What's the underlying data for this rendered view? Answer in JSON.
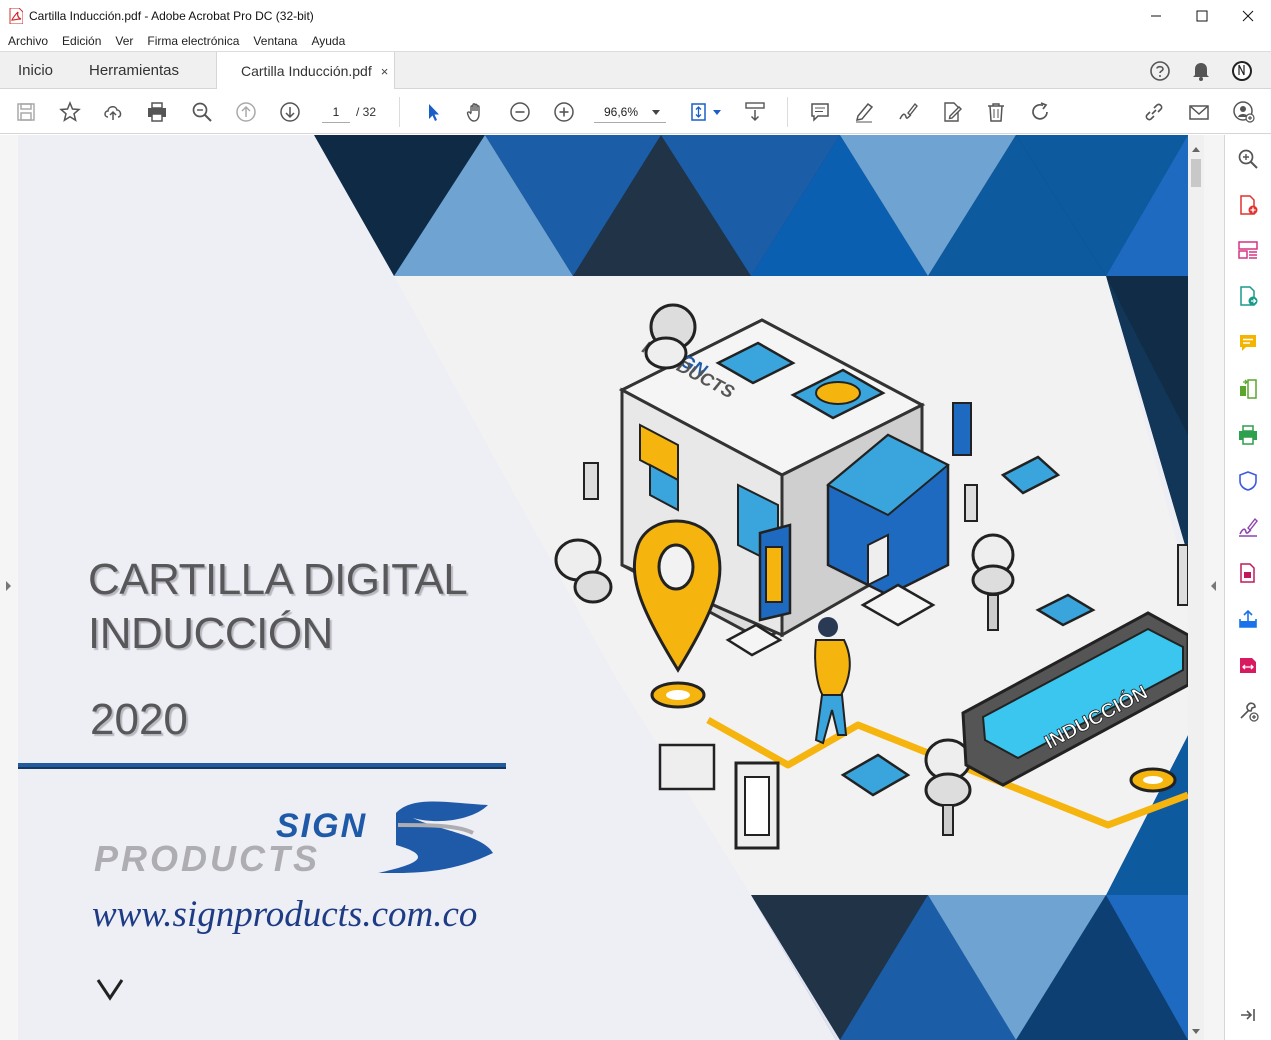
{
  "window": {
    "title": "Cartilla Inducción.pdf - Adobe Acrobat Pro DC (32-bit)"
  },
  "menu": [
    "Archivo",
    "Edición",
    "Ver",
    "Firma electrónica",
    "Ventana",
    "Ayuda"
  ],
  "tabs": {
    "home": "Inicio",
    "tools": "Herramientas",
    "document": "Cartilla Inducción.pdf",
    "close": "×"
  },
  "toolbar": {
    "page_current": "1",
    "page_total": "/  32",
    "zoom": "96,6%"
  },
  "document": {
    "title_line1": "CARTILLA DIGITAL",
    "title_line2": "INDUCCIÓN",
    "year": "2020",
    "brand_top": "SIGN",
    "brand_bottom": "PRODUCTS",
    "website": "www.signproducts.com.co",
    "illustration_store_sign_1": "SIGN",
    "illustration_store_sign_2": "PRODUCTS",
    "illustration_tablet_text": "INDUCCIÓN"
  },
  "colors": {
    "brand_blue": "#1e5aa8",
    "dark_navy": "#0e2a45",
    "light_blue": "#6fa3d2",
    "accent_yellow": "#f6b40e",
    "acrobat_red": "#d8232a"
  },
  "icons": {
    "toolbar": [
      "save-icon",
      "bookmark-star-icon",
      "upload-cloud-icon",
      "print-icon",
      "find-icon",
      "previous-page-icon",
      "next-page-icon",
      "select-arrow-icon",
      "hand-icon",
      "zoom-out-icon",
      "zoom-in-icon",
      "fit-page-icon",
      "scroll-mode-icon",
      "comment-icon",
      "highlight-icon",
      "sign-icon",
      "fill-sign-icon",
      "delete-icon",
      "rotate-icon",
      "link-icon",
      "mail-icon",
      "add-user-icon"
    ],
    "right_pane": [
      "search-zoom-icon",
      "create-pdf-icon",
      "organize-icon",
      "export-pdf-icon",
      "comment-tool-icon",
      "compare-icon",
      "print-production-icon",
      "protect-icon",
      "fill-sign-tool-icon",
      "edit-pdf-icon",
      "share-icon",
      "compress-icon",
      "more-tools-icon",
      "collapse-pane-icon"
    ]
  }
}
